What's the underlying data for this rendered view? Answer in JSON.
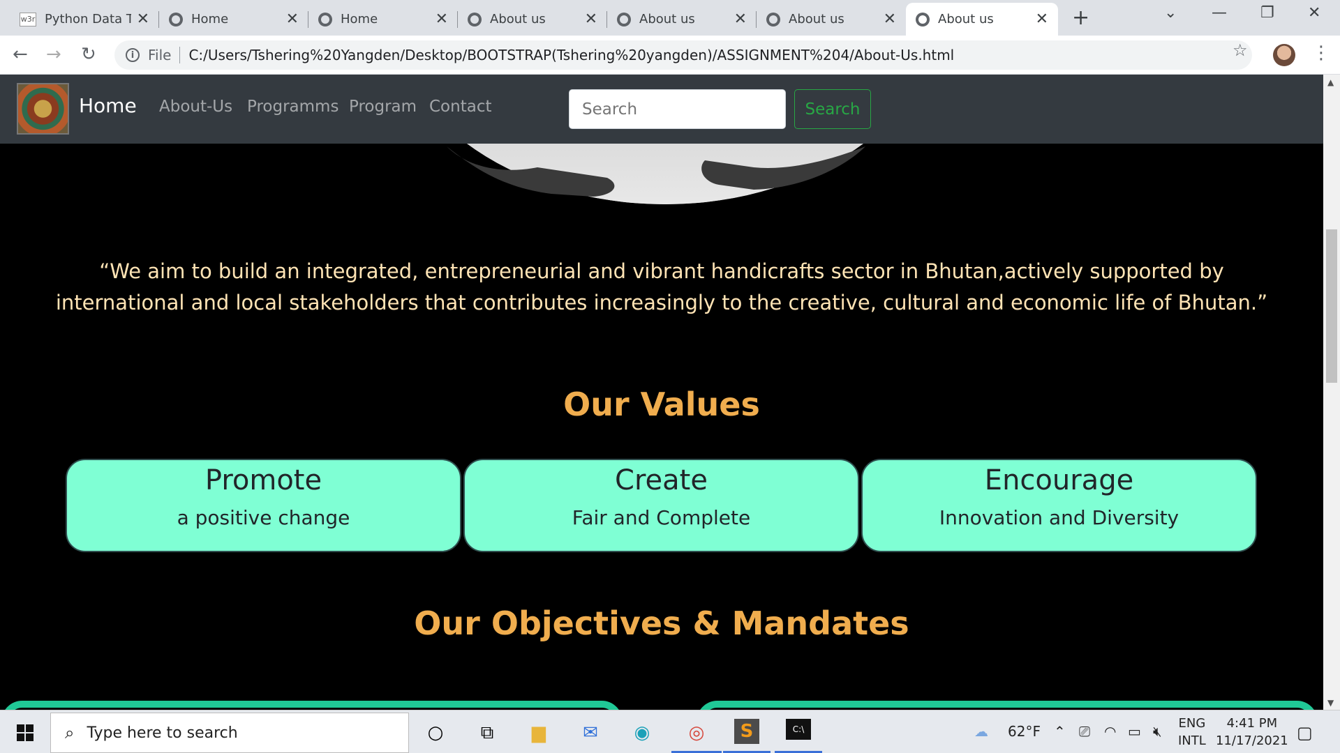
{
  "browser": {
    "tabs": [
      {
        "title": "Python Data Ty",
        "icon": "w3r"
      },
      {
        "title": "Home",
        "icon": "globe"
      },
      {
        "title": "Home",
        "icon": "globe"
      },
      {
        "title": "About us",
        "icon": "globe"
      },
      {
        "title": "About us",
        "icon": "globe"
      },
      {
        "title": "About us",
        "icon": "globe"
      },
      {
        "title": "About us",
        "icon": "globe"
      }
    ],
    "active_tab_index": 6,
    "address": {
      "scheme_label": "File",
      "url": "C:/Users/Tshering%20Yangden/Desktop/BOOTSTRAP(Tshering%20yangden)/ASSIGNMENT%204/About-Us.html"
    }
  },
  "site": {
    "brand": "Home",
    "nav_links": [
      "About-Us",
      "Programms",
      "Program",
      "Contact"
    ],
    "search": {
      "placeholder": "Search",
      "button_label": "Search"
    },
    "mission": "“We aim to build an integrated, entrepreneurial and vibrant handicrafts sector in Bhutan,actively supported by international and local stakeholders that contributes increasingly to the creative, cultural and economic life of Bhutan.”",
    "values_title": "Our Values",
    "values": [
      {
        "title": "Promote",
        "subtitle": "a positive change"
      },
      {
        "title": "Create",
        "subtitle": "Fair and Complete"
      },
      {
        "title": "Encourage",
        "subtitle": "Innovation and Diversity"
      }
    ],
    "objectives_title": "Our Objectives & Mandates"
  },
  "colors": {
    "navbar": "#343a40",
    "mission_text": "#ffe4b5",
    "section_title": "#f0ad4e",
    "value_card_bg": "#7fffd4",
    "objective_border": "#20c997",
    "search_button": "#28a745"
  },
  "taskbar": {
    "search_placeholder": "Type here to search",
    "weather": "62°F",
    "lang_top": "ENG",
    "lang_bottom": "INTL",
    "time": "4:41 PM",
    "date": "11/17/2021",
    "pinned_icons": [
      "cortana-icon",
      "task-view-icon",
      "file-explorer-icon",
      "mail-icon",
      "edge-icon",
      "chrome-icon",
      "sublime-text-icon",
      "terminal-icon"
    ]
  }
}
